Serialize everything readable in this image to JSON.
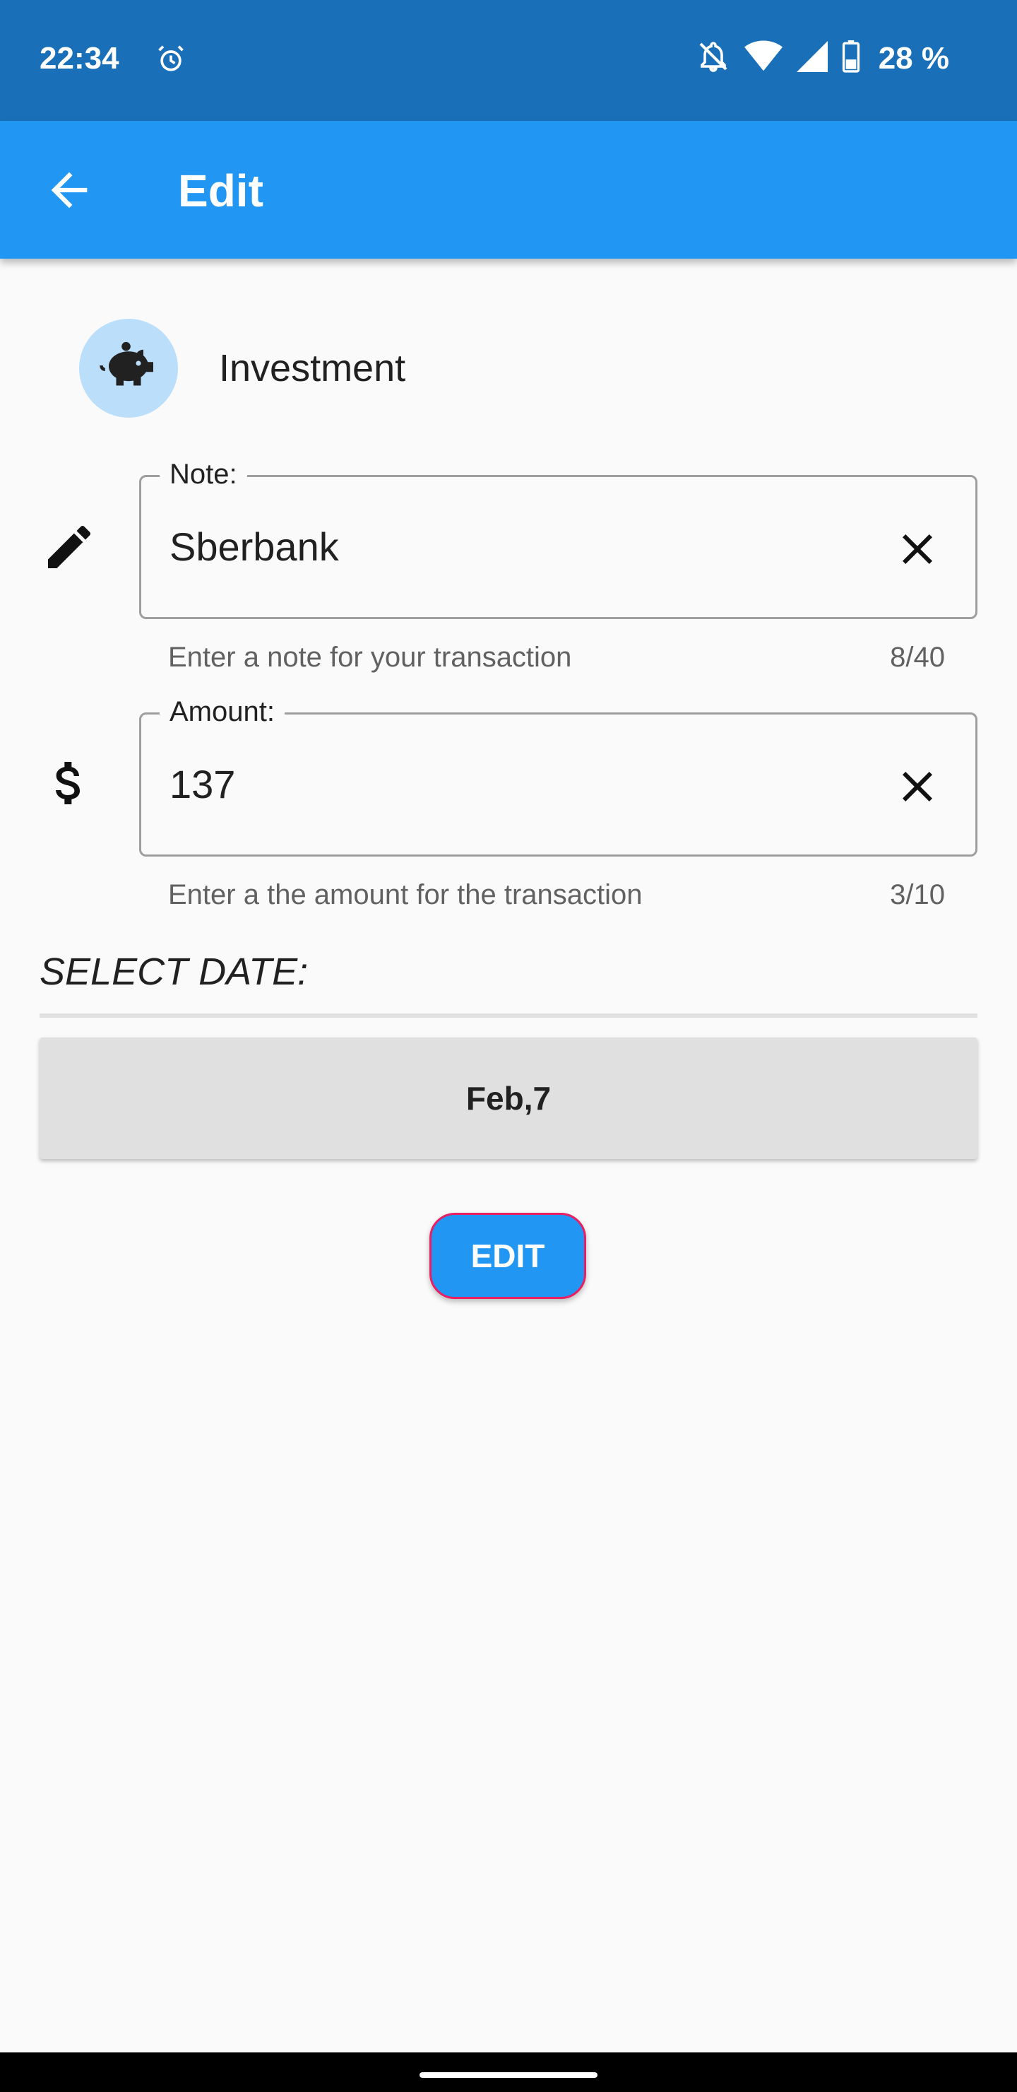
{
  "status_bar": {
    "time": "22:34",
    "battery": "28 %",
    "icons": [
      "alarm-icon",
      "bell-off-icon",
      "wifi-icon",
      "signal-icon",
      "battery-icon"
    ]
  },
  "app_bar": {
    "title": "Edit",
    "back_icon": "arrow-back-icon",
    "color": "#2196f3"
  },
  "category": {
    "label": "Investment",
    "icon": "piggy-bank-icon",
    "avatar_color": "#bbdefb"
  },
  "note_field": {
    "label": "Note:",
    "value": "Sberbank",
    "helper": "Enter a note for your transaction",
    "counter": "8/40",
    "icon": "pencil-icon"
  },
  "amount_field": {
    "label": "Amount:",
    "value": "137",
    "helper": "Enter a the amount for the transaction",
    "counter": "3/10",
    "icon": "dollar-icon"
  },
  "date": {
    "label": "SELECT DATE:",
    "value": "Feb,7"
  },
  "actions": {
    "edit_label": "EDIT",
    "edit_color": "#2196f3",
    "edit_border": "#e91e63"
  }
}
